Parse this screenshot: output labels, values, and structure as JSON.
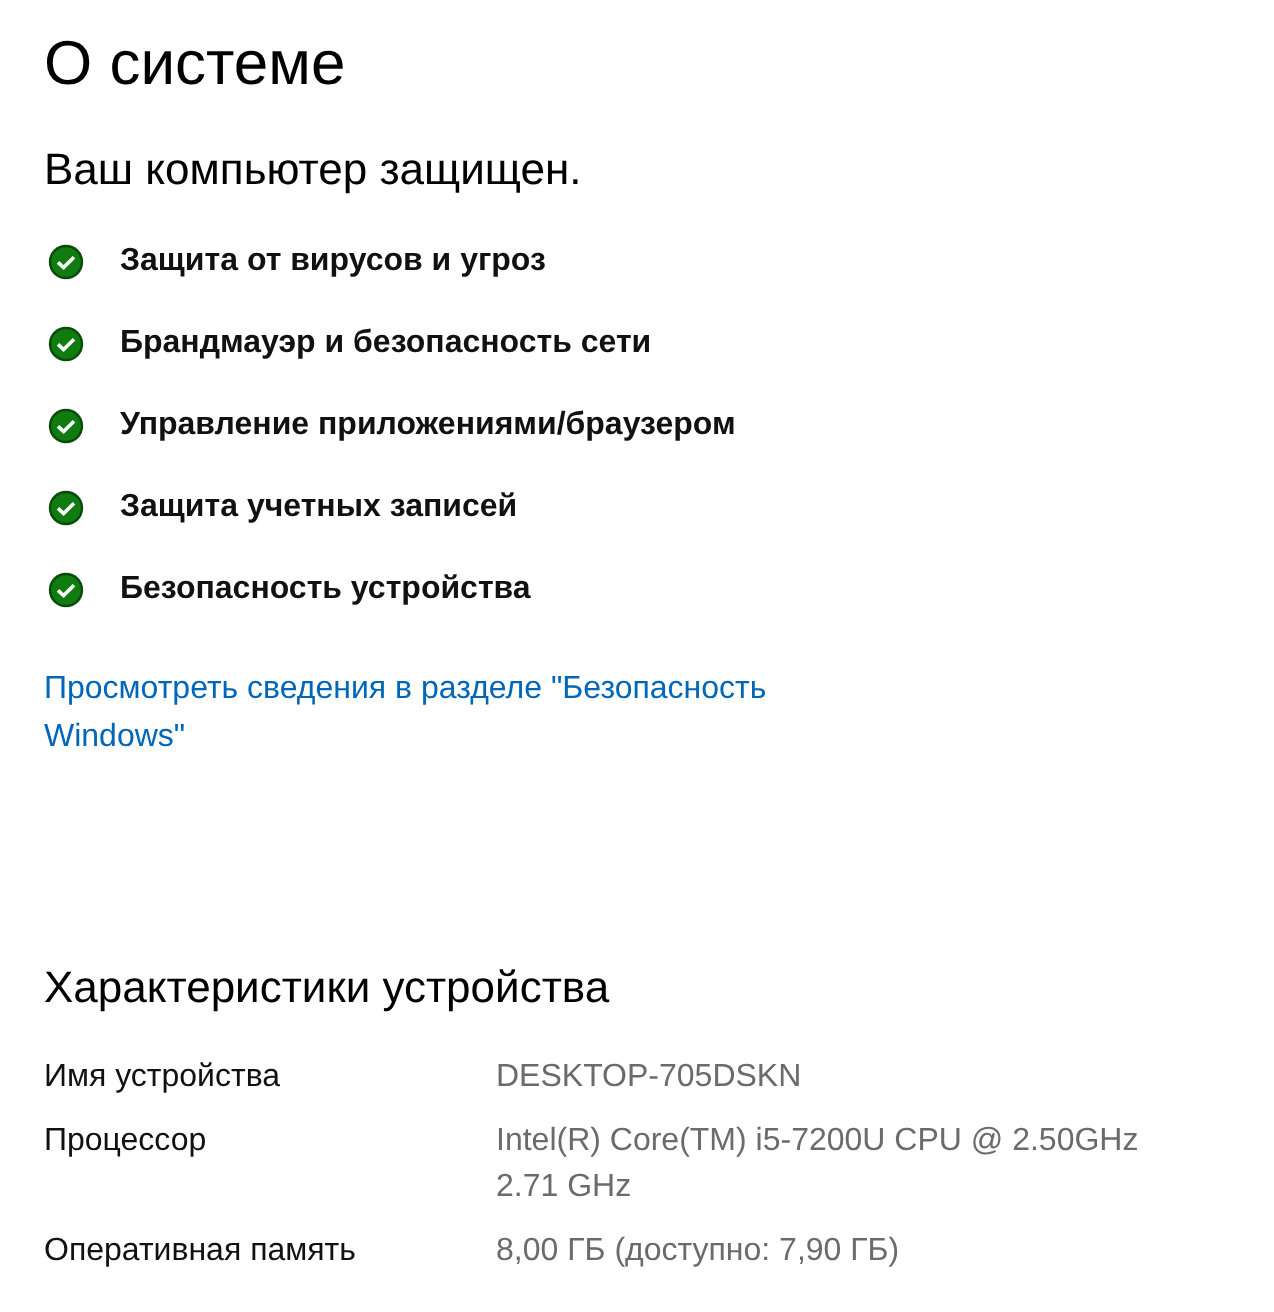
{
  "title": "О системе",
  "protection": {
    "heading": "Ваш компьютер защищен.",
    "items": [
      {
        "label": "Защита от вирусов и угроз",
        "kind": "ok"
      },
      {
        "label": "Брандмауэр и безопасность сети",
        "kind": "ok"
      },
      {
        "label": "Управление приложениями/браузером",
        "kind": "ok"
      },
      {
        "label": "Защита учетных записей",
        "kind": "ok"
      },
      {
        "label": "Безопасность устройства",
        "kind": "ok"
      }
    ],
    "link": "Просмотреть сведения в разделе \"Безопасность Windows\""
  },
  "specs": {
    "heading": "Характеристики устройства",
    "rows": [
      {
        "label": "Имя устройства",
        "value": "DESKTOP-705DSKN"
      },
      {
        "label": "Процессор",
        "value": "Intel(R) Core(TM) i5-7200U CPU @ 2.50GHz 2.71 GHz"
      },
      {
        "label": "Оперативная память",
        "value": "8,00 ГБ (доступно: 7,90 ГБ)"
      }
    ]
  }
}
